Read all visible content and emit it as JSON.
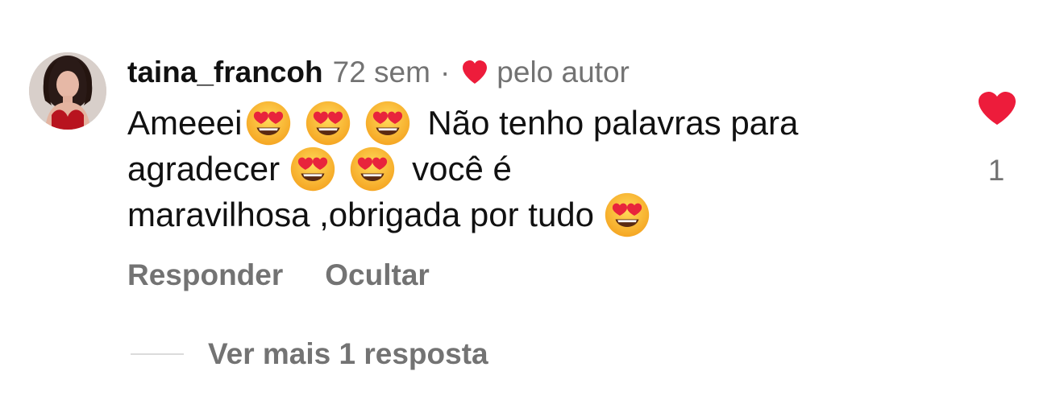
{
  "comment": {
    "username": "taina_francoh",
    "time_ago": "72 sem",
    "separator": "·",
    "liked_by_author_label": "pelo autor",
    "text_lines": [
      {
        "before": "Ameeei",
        "after": "Não tenho palavras para"
      },
      {
        "before": "agradecer",
        "after": "você é"
      },
      {
        "before": "maravilhosa ,obrigada por tudo",
        "after": ""
      }
    ],
    "emoji": "heart-eyes",
    "like_count": "1"
  },
  "actions": {
    "reply_label": "Responder",
    "hide_label": "Ocultar"
  },
  "replies": {
    "view_more_label": "Ver mais 1 resposta"
  },
  "colors": {
    "text": "#111111",
    "secondary": "#737373",
    "heart": "#ed1c3b",
    "divider": "#dbdbdb"
  },
  "icons": {
    "author_like": "heart-icon",
    "like_button": "heart-icon",
    "emoji": "heart-eyes-emoji-icon"
  }
}
